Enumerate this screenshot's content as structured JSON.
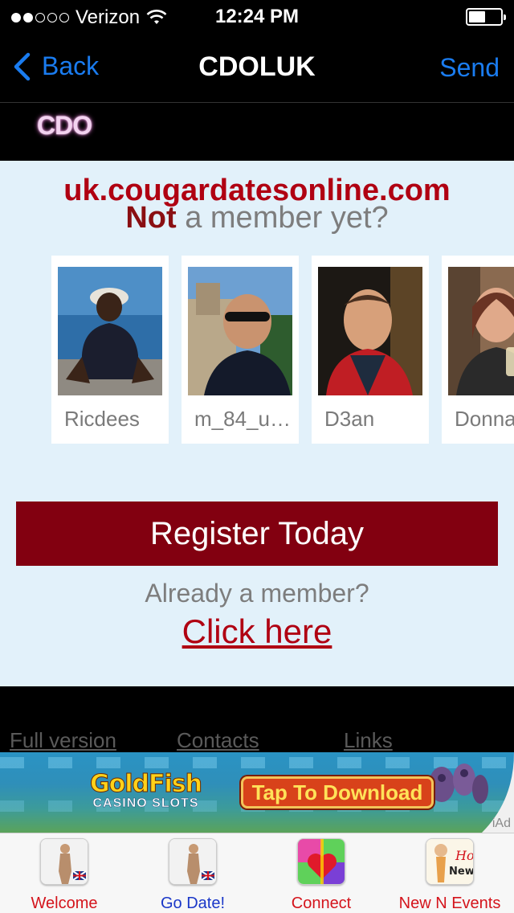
{
  "status_bar": {
    "carrier": "Verizon",
    "time": "12:24 PM",
    "signal_filled": 2,
    "signal_total": 5,
    "battery_level": 0.45
  },
  "navbar": {
    "back_label": "Back",
    "title": "CDOLUK",
    "send_label": "Send"
  },
  "logo_text": "CDO",
  "content": {
    "site_url": "uk.cougardatesonline.com",
    "not_word": "Not",
    "not_rest": " a member yet?",
    "profiles": [
      {
        "name": "Ricdees"
      },
      {
        "name": "m_84_u…"
      },
      {
        "name": "D3an"
      },
      {
        "name": "Donna"
      }
    ],
    "register_label": "Register Today",
    "already_text": "Already a member?",
    "click_here": "Click here"
  },
  "footer_links": {
    "full_version": "Full version",
    "contacts": "Contacts",
    "links": "Links"
  },
  "ad": {
    "brand": "GoldFish",
    "subtitle": "CASINO SLOTS",
    "cta": "Tap To Download",
    "badge": "iAd"
  },
  "tabs": [
    {
      "label": "Welcome",
      "color": "#d4141c",
      "icon": "person-uk-flag-icon"
    },
    {
      "label": "Go Date!",
      "color": "#1a37c8",
      "icon": "person-uk-flag-icon"
    },
    {
      "label": "Connect",
      "color": "#d4141c",
      "icon": "gift-hearts-icon"
    },
    {
      "label": "New N Events",
      "color": "#d4141c",
      "icon": "hot-news-icon"
    }
  ]
}
